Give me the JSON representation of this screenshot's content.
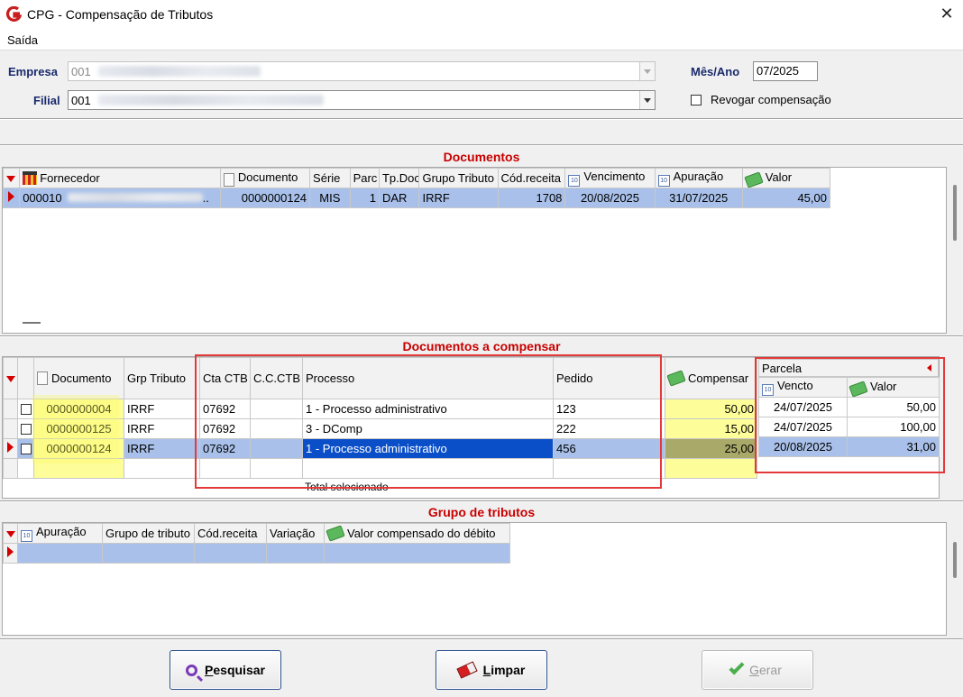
{
  "window": {
    "title": "CPG - Compensação de Tributos",
    "close": "✕"
  },
  "menu": {
    "saida": "Saída"
  },
  "header": {
    "empresa_label": "Empresa",
    "empresa_code": "001",
    "filial_label": "Filial",
    "filial_code": "001",
    "mes_ano_label": "Mês/Ano",
    "mes_ano_value": "07/2025",
    "revogar_label": "Revogar compensação"
  },
  "documentos": {
    "title": "Documentos",
    "columns": [
      "Fornecedor",
      "Documento",
      "Série",
      "Parc",
      "Tp.Doc",
      "Grupo Tributo",
      "Cód.receita",
      "Vencimento",
      "Apuração",
      "Valor"
    ],
    "rows": [
      {
        "fornecedor": "000010",
        "fornecedor_suffix": "..",
        "documento": "0000000124",
        "serie": "MIS",
        "parc": "1",
        "tpdoc": "DAR",
        "grupo": "IRRF",
        "codreceita": "1708",
        "vencimento": "20/08/2025",
        "apuracao": "31/07/2025",
        "valor": "45,00"
      }
    ]
  },
  "compensar": {
    "title": "Documentos a compensar",
    "columns": [
      "Documento",
      "Grp Tributo",
      "Cta CTB",
      "C.C.CTB",
      "Processo",
      "Pedido",
      "Compensar"
    ],
    "parcela_label": "Parcela",
    "parcela_columns": [
      "Vencto",
      "Valor"
    ],
    "rows": [
      {
        "documento": "0000000004",
        "grp": "IRRF",
        "cta": "07692",
        "cc": "",
        "processo": "1 - Processo administrativo",
        "pedido": "123",
        "compensar": "50,00",
        "vencto": "24/07/2025",
        "valor": "50,00"
      },
      {
        "documento": "0000000125",
        "grp": "IRRF",
        "cta": "07692",
        "cc": "",
        "processo": "3 - DComp",
        "pedido": "222",
        "compensar": "15,00",
        "vencto": "24/07/2025",
        "valor": "100,00"
      },
      {
        "documento": "0000000124",
        "grp": "IRRF",
        "cta": "07692",
        "cc": "",
        "processo": "1 - Processo administrativo",
        "pedido": "456",
        "compensar": "25,00",
        "vencto": "20/08/2025",
        "valor": "31,00"
      }
    ],
    "total_label": "Total selecionado"
  },
  "grupo": {
    "title": "Grupo de tributos",
    "columns": [
      "Apuração",
      "Grupo de tributo",
      "Cód.receita",
      "Variação",
      "Valor compensado do débito"
    ]
  },
  "buttons": {
    "pesquisar_u": "P",
    "pesquisar_rest": "esquisar",
    "limpar_u": "L",
    "limpar_rest": "impar",
    "gerar_u": "G",
    "gerar_rest": "erar"
  }
}
